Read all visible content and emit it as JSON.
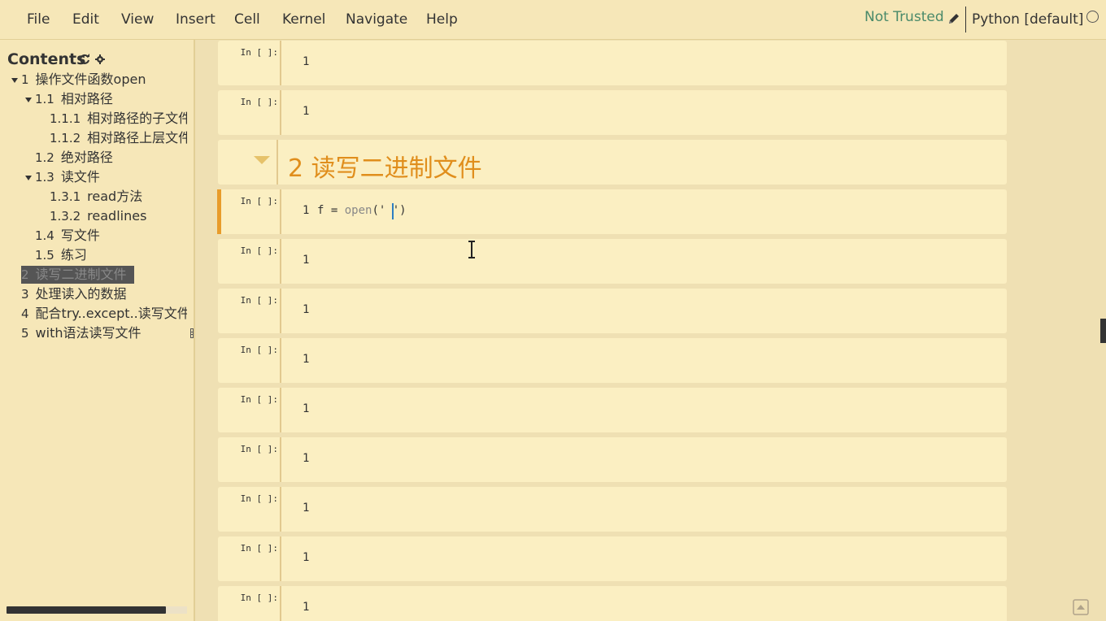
{
  "menubar": {
    "items": [
      "File",
      "Edit",
      "View",
      "Insert",
      "Cell",
      "Kernel",
      "Navigate",
      "Help"
    ],
    "trust_status": "Not Trusted",
    "kernel_name": "Python [default]"
  },
  "toc": {
    "title": "Contents",
    "items": [
      {
        "num": "1",
        "label": "操作文件函数open",
        "expanded": true
      },
      {
        "num": "1.1",
        "label": "相对路径",
        "expanded": true
      },
      {
        "num": "1.1.1",
        "label": "相对路径的子文件"
      },
      {
        "num": "1.1.2",
        "label": "相对路径上层文件"
      },
      {
        "num": "1.2",
        "label": "绝对路径"
      },
      {
        "num": "1.3",
        "label": "读文件",
        "expanded": true
      },
      {
        "num": "1.3.1",
        "label": "read方法"
      },
      {
        "num": "1.3.2",
        "label": "readlines"
      },
      {
        "num": "1.4",
        "label": "写文件"
      },
      {
        "num": "1.5",
        "label": "练习"
      },
      {
        "num": "2",
        "label": "读写二进制文件",
        "active": true
      },
      {
        "num": "3",
        "label": "处理读入的数据"
      },
      {
        "num": "4",
        "label": "配合try..except..读写文件"
      },
      {
        "num": "5",
        "label": "with语法读写文件"
      }
    ]
  },
  "notebook": {
    "prompt": "In [ ]:",
    "line_number": "1",
    "heading": "2  读写二进制文件",
    "active_code": {
      "plain": "f = ",
      "func": "open",
      "rest": "(' ')"
    }
  },
  "colors": {
    "background": "#efe0b3",
    "cell": "#fbefc2",
    "accent": "#e89c2b",
    "heading": "#e08e1c",
    "trusted_text": "#4a8a6a"
  }
}
